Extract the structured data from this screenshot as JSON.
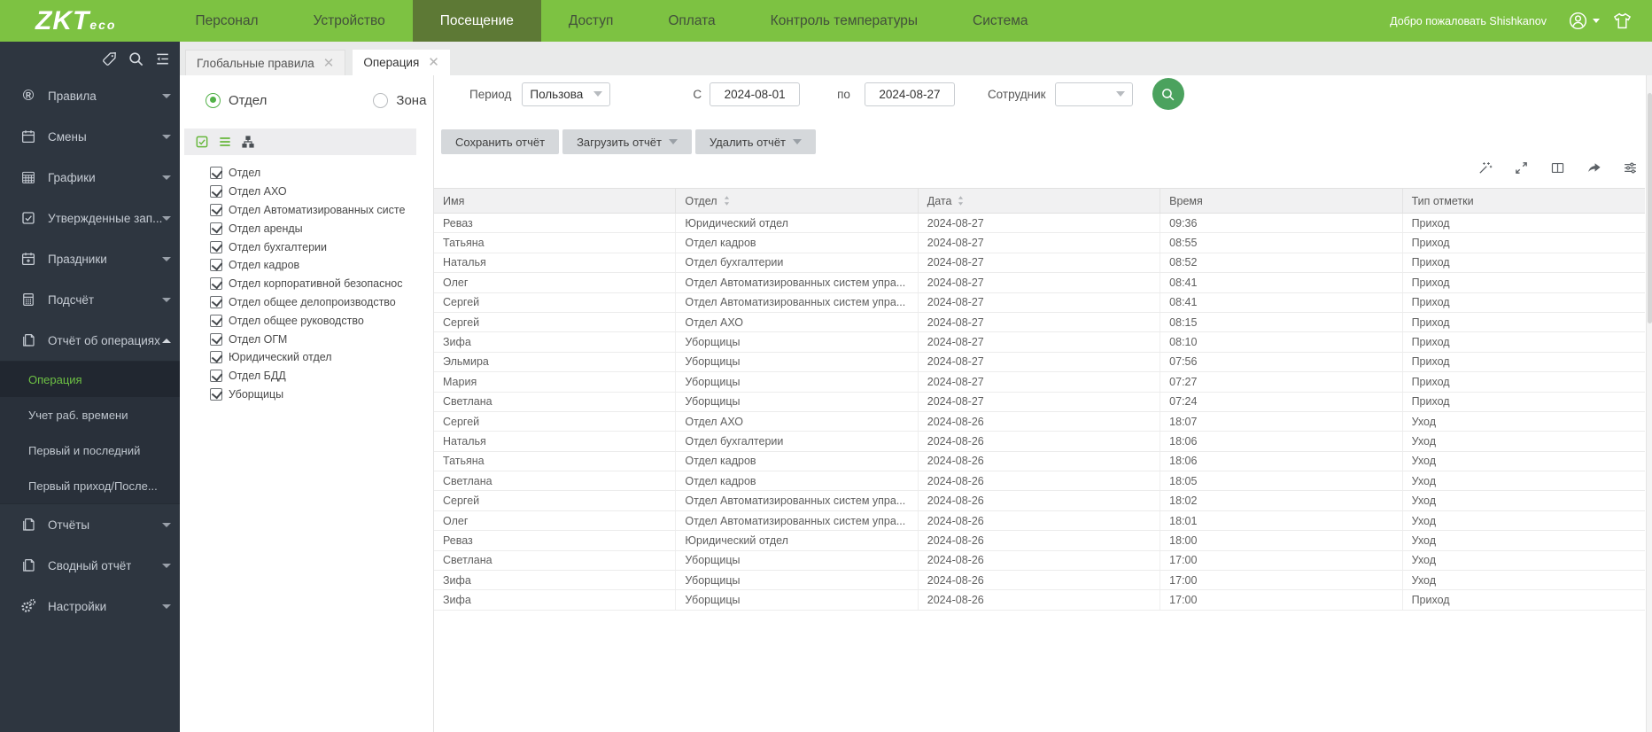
{
  "colors": {
    "navbar_green": "#7dc242",
    "nav_active_green": "#5d7935",
    "sidebar_dark": "#2e3640",
    "accent_green": "#6dc044",
    "search_button_green": "#4ba25e"
  },
  "navbar": {
    "logo_zkt": "ZKT",
    "logo_eco": "eco",
    "items": [
      {
        "label": "Персонал",
        "active": false
      },
      {
        "label": "Устройство",
        "active": false
      },
      {
        "label": "Посещение",
        "active": true
      },
      {
        "label": "Доступ",
        "active": false
      },
      {
        "label": "Оплата",
        "active": false
      },
      {
        "label": "Контроль температуры",
        "active": false
      },
      {
        "label": "Система",
        "active": false
      }
    ],
    "welcome": "Добро пожаловать Shishkanov",
    "right_icons": [
      "user-icon",
      "caret-down-icon",
      "shirt-icon"
    ]
  },
  "sidebar": {
    "tool_icons": [
      "tag-icon",
      "search-icon",
      "menu-list-icon"
    ],
    "items": [
      {
        "label": "Правила",
        "icon": "registered-icon",
        "expanded": false
      },
      {
        "label": "Смены",
        "icon": "calendar-icon",
        "expanded": false
      },
      {
        "label": "Графики",
        "icon": "calendar-grid-icon",
        "expanded": false
      },
      {
        "label": "Утвержденные зап...",
        "icon": "check-square-icon",
        "expanded": false
      },
      {
        "label": "Праздники",
        "icon": "calendar-plus-icon",
        "expanded": false
      },
      {
        "label": "Подсчёт",
        "icon": "calculator-icon",
        "expanded": false
      },
      {
        "label": "Отчёт об операциях",
        "icon": "report-icon",
        "expanded": true,
        "children": [
          {
            "label": "Операция",
            "active": true
          },
          {
            "label": "Учет раб. времени",
            "active": false
          },
          {
            "label": "Первый и последний",
            "active": false
          },
          {
            "label": "Первый приход/После...",
            "active": false
          }
        ]
      },
      {
        "label": "Отчёты",
        "icon": "report-icon",
        "expanded": false
      },
      {
        "label": "Сводный отчёт",
        "icon": "report-icon",
        "expanded": false
      },
      {
        "label": "Настройки",
        "icon": "gear-icon",
        "expanded": false
      }
    ]
  },
  "tabs": [
    {
      "label": "Глобальные правила",
      "active": false
    },
    {
      "label": "Операция",
      "active": true
    }
  ],
  "left_panel": {
    "radios": [
      {
        "label": "Отдел",
        "selected": true
      },
      {
        "label": "Зона",
        "selected": false
      }
    ],
    "toolbar_icons": [
      "check-all-icon",
      "list-view-icon",
      "tree-view-icon"
    ],
    "tree_items": [
      {
        "label": "Отдел",
        "checked": true
      },
      {
        "label": "Отдел АХО",
        "checked": true
      },
      {
        "label": "Отдел Автоматизированных систе",
        "checked": true
      },
      {
        "label": "Отдел аренды",
        "checked": true
      },
      {
        "label": "Отдел бухгалтерии",
        "checked": true
      },
      {
        "label": "Отдел кадров",
        "checked": true
      },
      {
        "label": "Отдел корпоративной безопаснос",
        "checked": true
      },
      {
        "label": "Отдел общее делопроизводство",
        "checked": true
      },
      {
        "label": "Отдел общее руководство",
        "checked": true
      },
      {
        "label": "Отдел ОГМ",
        "checked": true
      },
      {
        "label": "Юридический отдел",
        "checked": true
      },
      {
        "label": "Отдел БДД",
        "checked": true
      },
      {
        "label": "Уборщицы",
        "checked": true
      }
    ]
  },
  "filters": {
    "period_label": "Период",
    "period_value": "Пользова",
    "from_label": "С",
    "from_value": "2024-08-01",
    "to_label": "по",
    "to_value": "2024-08-27",
    "employee_label": "Сотрудник",
    "employee_value": ""
  },
  "report_buttons": [
    {
      "label": "Сохранить отчёт",
      "caret": false
    },
    {
      "label": "Загрузить отчёт",
      "caret": true
    },
    {
      "label": "Удалить отчёт",
      "caret": true
    }
  ],
  "table_toolbar_icons": [
    "wand-icon",
    "expand-icon",
    "columns-icon",
    "export-icon",
    "sliders-icon"
  ],
  "table": {
    "columns": [
      {
        "label": "Имя",
        "sortable": false
      },
      {
        "label": "Отдел",
        "sortable": true
      },
      {
        "label": "Дата",
        "sortable": true
      },
      {
        "label": "Время",
        "sortable": false
      },
      {
        "label": "Тип отметки",
        "sortable": false
      }
    ],
    "rows": [
      {
        "name": "Реваз",
        "dept": "Юридический отдел",
        "date": "2024-08-27",
        "time": "09:36",
        "type": "Приход"
      },
      {
        "name": "Татьяна",
        "dept": "Отдел кадров",
        "date": "2024-08-27",
        "time": "08:55",
        "type": "Приход"
      },
      {
        "name": "Наталья",
        "dept": "Отдел бухгалтерии",
        "date": "2024-08-27",
        "time": "08:52",
        "type": "Приход"
      },
      {
        "name": "Олег",
        "dept": "Отдел Автоматизированных систем упра...",
        "date": "2024-08-27",
        "time": "08:41",
        "type": "Приход"
      },
      {
        "name": "Сергей",
        "dept": "Отдел Автоматизированных систем упра...",
        "date": "2024-08-27",
        "time": "08:41",
        "type": "Приход"
      },
      {
        "name": "Сергей",
        "dept": "Отдел АХО",
        "date": "2024-08-27",
        "time": "08:15",
        "type": "Приход"
      },
      {
        "name": "Зифа",
        "dept": "Уборщицы",
        "date": "2024-08-27",
        "time": "08:10",
        "type": "Приход"
      },
      {
        "name": "Эльмира",
        "dept": "Уборщицы",
        "date": "2024-08-27",
        "time": "07:56",
        "type": "Приход"
      },
      {
        "name": "Мария",
        "dept": "Уборщицы",
        "date": "2024-08-27",
        "time": "07:27",
        "type": "Приход"
      },
      {
        "name": "Светлана",
        "dept": "Уборщицы",
        "date": "2024-08-27",
        "time": "07:24",
        "type": "Приход"
      },
      {
        "name": "Сергей",
        "dept": "Отдел АХО",
        "date": "2024-08-26",
        "time": "18:07",
        "type": "Уход"
      },
      {
        "name": "Наталья",
        "dept": "Отдел бухгалтерии",
        "date": "2024-08-26",
        "time": "18:06",
        "type": "Уход"
      },
      {
        "name": "Татьяна",
        "dept": "Отдел кадров",
        "date": "2024-08-26",
        "time": "18:06",
        "type": "Уход"
      },
      {
        "name": "Светлана",
        "dept": "Отдел кадров",
        "date": "2024-08-26",
        "time": "18:05",
        "type": "Уход"
      },
      {
        "name": "Сергей",
        "dept": "Отдел Автоматизированных систем упра...",
        "date": "2024-08-26",
        "time": "18:02",
        "type": "Уход"
      },
      {
        "name": "Олег",
        "dept": "Отдел Автоматизированных систем упра...",
        "date": "2024-08-26",
        "time": "18:01",
        "type": "Уход"
      },
      {
        "name": "Реваз",
        "dept": "Юридический отдел",
        "date": "2024-08-26",
        "time": "18:00",
        "type": "Уход"
      },
      {
        "name": "Светлана",
        "dept": "Уборщицы",
        "date": "2024-08-26",
        "time": "17:00",
        "type": "Уход"
      },
      {
        "name": "Зифа",
        "dept": "Уборщицы",
        "date": "2024-08-26",
        "time": "17:00",
        "type": "Уход"
      },
      {
        "name": "Зифа",
        "dept": "Уборщицы",
        "date": "2024-08-26",
        "time": "17:00",
        "type": "Приход"
      }
    ]
  }
}
